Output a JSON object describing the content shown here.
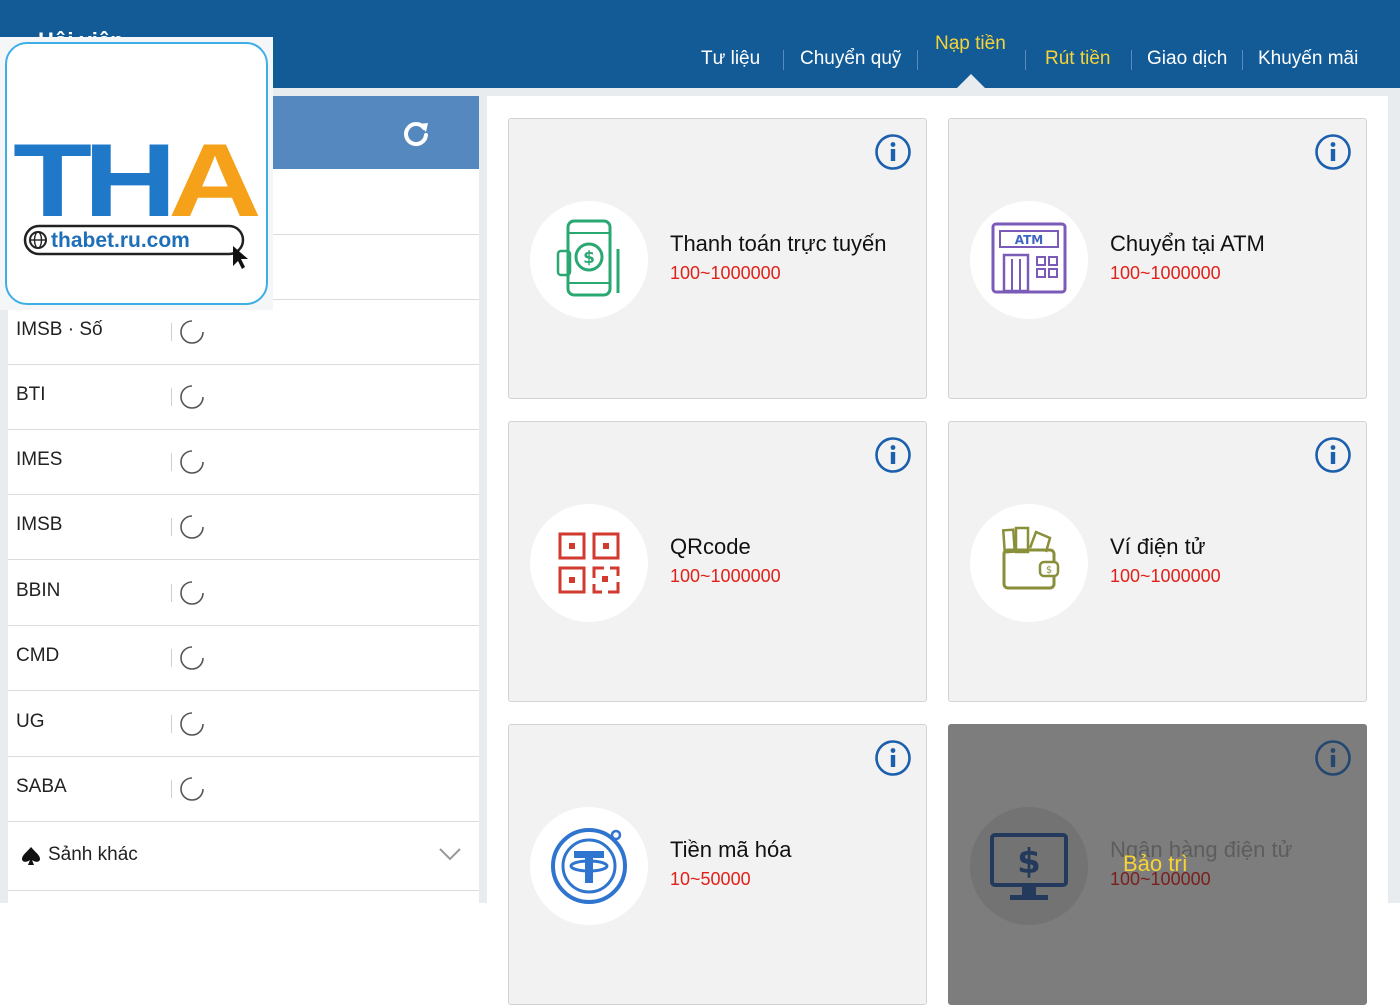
{
  "header": {
    "title": "Hội viên",
    "nav": [
      {
        "label": "Tư liệu"
      },
      {
        "label": "Chuyển quỹ"
      },
      {
        "label": "Nạp tiền"
      },
      {
        "label": "Rút tiền"
      },
      {
        "label": "Giao dịch"
      },
      {
        "label": "Khuyến mãi"
      }
    ]
  },
  "logo": {
    "mark": "THA",
    "url": "thabet.ru.com"
  },
  "sidebar": {
    "rows": [
      {
        "label": "IMSB · Số"
      },
      {
        "label": "BTI"
      },
      {
        "label": "IMES"
      },
      {
        "label": "IMSB"
      },
      {
        "label": "BBIN"
      },
      {
        "label": "CMD"
      },
      {
        "label": "UG"
      },
      {
        "label": "SABA"
      }
    ],
    "more_label": "Sảnh khác"
  },
  "methods": [
    {
      "title": "Thanh toán trực tuyến",
      "range": "100~1000000",
      "icon": "mobile-payment-icon"
    },
    {
      "title": "Chuyển tại ATM",
      "range": "100~1000000",
      "icon": "atm-icon"
    },
    {
      "title": "QRcode",
      "range": "100~1000000",
      "icon": "qrcode-icon"
    },
    {
      "title": "Ví điện tử",
      "range": "100~1000000",
      "icon": "wallet-icon"
    },
    {
      "title": "Tiền mã hóa",
      "range": "10~50000",
      "icon": "tether-icon"
    },
    {
      "title": "Ngân hàng điện tử",
      "range": "100~100000",
      "icon": "online-bank-icon",
      "status": "Bảo trì"
    }
  ],
  "colors": {
    "header": "#135b97",
    "accent_gold": "#f7d435",
    "range_red": "#e0211a",
    "logo_blue": "#1f78c8",
    "logo_orange": "#f6a11a",
    "sidebar_head": "#5488bf"
  }
}
